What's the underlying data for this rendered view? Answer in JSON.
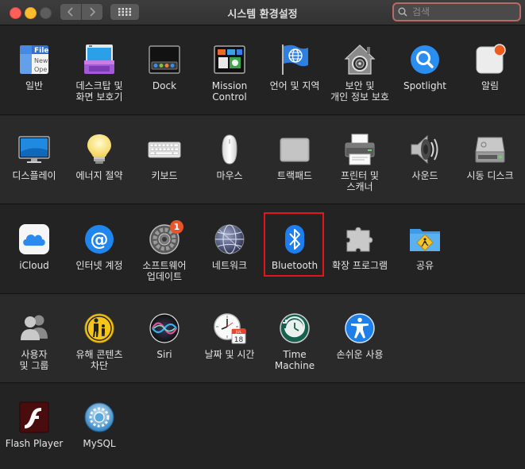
{
  "window": {
    "title": "시스템 환경설정",
    "search_placeholder": "검색"
  },
  "colors": {
    "accent_highlight": "#e1151b",
    "badge": "#e8552a"
  },
  "sections": [
    {
      "panes": [
        {
          "id": "general",
          "label": "일반",
          "icon": "general-icon"
        },
        {
          "id": "desktop",
          "label": "데스크탑 및\n화면 보호기",
          "icon": "desktop-icon"
        },
        {
          "id": "dock",
          "label": "Dock",
          "icon": "dock-icon"
        },
        {
          "id": "mission",
          "label": "Mission\nControl",
          "icon": "mission-control-icon"
        },
        {
          "id": "language",
          "label": "언어 및 지역",
          "icon": "flag-globe-icon"
        },
        {
          "id": "security",
          "label": "보안 및\n개인 정보 보호",
          "icon": "house-lock-icon"
        },
        {
          "id": "spotlight",
          "label": "Spotlight",
          "icon": "magnifier-icon"
        },
        {
          "id": "notifications",
          "label": "알림",
          "icon": "notifications-icon"
        }
      ]
    },
    {
      "panes": [
        {
          "id": "displays",
          "label": "디스플레이",
          "icon": "monitor-icon"
        },
        {
          "id": "energy",
          "label": "에너지 절약",
          "icon": "lightbulb-icon"
        },
        {
          "id": "keyboard",
          "label": "키보드",
          "icon": "keyboard-icon"
        },
        {
          "id": "mouse",
          "label": "마우스",
          "icon": "mouse-icon"
        },
        {
          "id": "trackpad",
          "label": "트랙패드",
          "icon": "trackpad-icon"
        },
        {
          "id": "printers",
          "label": "프린터 및\n스캐너",
          "icon": "printer-icon"
        },
        {
          "id": "sound",
          "label": "사운드",
          "icon": "speaker-icon"
        },
        {
          "id": "startup",
          "label": "시동 디스크",
          "icon": "hard-disk-icon"
        }
      ]
    },
    {
      "panes": [
        {
          "id": "icloud",
          "label": "iCloud",
          "icon": "cloud-icon"
        },
        {
          "id": "internet",
          "label": "인터넷 계정",
          "icon": "at-sign-icon"
        },
        {
          "id": "update",
          "label": "소프트웨어\n업데이트",
          "icon": "gear-icon",
          "badge": "1"
        },
        {
          "id": "network",
          "label": "네트워크",
          "icon": "globe-network-icon"
        },
        {
          "id": "bluetooth",
          "label": "Bluetooth",
          "icon": "bluetooth-icon"
        },
        {
          "id": "extensions",
          "label": "확장 프로그램",
          "icon": "puzzle-icon"
        },
        {
          "id": "sharing",
          "label": "공유",
          "icon": "folder-sharing-icon"
        }
      ]
    },
    {
      "panes": [
        {
          "id": "users",
          "label": "사용자\n및 그룹",
          "icon": "users-icon"
        },
        {
          "id": "parental",
          "label": "유해 콘텐츠\n차단",
          "icon": "parental-controls-icon"
        },
        {
          "id": "siri",
          "label": "Siri",
          "icon": "siri-icon"
        },
        {
          "id": "datetime",
          "label": "날짜 및 시간",
          "icon": "clock-calendar-icon"
        },
        {
          "id": "timemachine",
          "label": "Time Machine",
          "icon": "time-machine-icon"
        },
        {
          "id": "accessibility",
          "label": "손쉬운 사용",
          "icon": "accessibility-icon"
        }
      ]
    },
    {
      "panes": [
        {
          "id": "flash",
          "label": "Flash Player",
          "icon": "flash-icon"
        },
        {
          "id": "mysql",
          "label": "MySQL",
          "icon": "mysql-icon"
        }
      ]
    }
  ],
  "calendar_icon": {
    "month": "JUL",
    "day": "18"
  },
  "general_icon_text": {
    "line1": "File",
    "line2": "New",
    "line3": "Ope"
  }
}
